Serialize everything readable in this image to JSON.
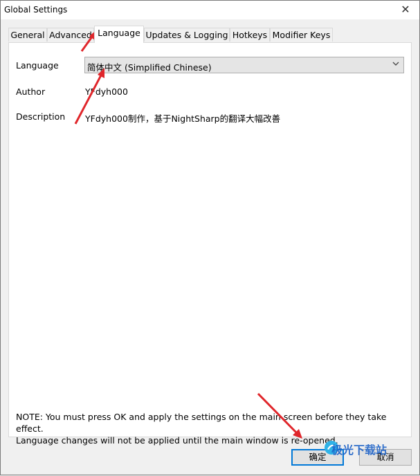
{
  "window": {
    "title": "Global Settings",
    "close_glyph": "✕"
  },
  "tabs": [
    {
      "label": "General"
    },
    {
      "label": "Advanced"
    },
    {
      "label": "Language"
    },
    {
      "label": "Updates & Logging"
    },
    {
      "label": "Hotkeys"
    },
    {
      "label": "Modifier Keys"
    }
  ],
  "active_tab": "Language",
  "language_panel": {
    "language_label": "Language",
    "language_value": "简体中文 (Simplified Chinese)",
    "author_label": "Author",
    "author_value": "YFdyh000",
    "description_label": "Description",
    "description_value": "YFdyh000制作，基于NightSharp的翻译大幅改善"
  },
  "note": {
    "line1": "NOTE: You must press OK and apply the settings on the main screen before they take effect.",
    "line2": "Language changes will not be applied until the main window is re-opened."
  },
  "buttons": {
    "ok_label": "确定",
    "cancel_label": "取消"
  },
  "watermark": {
    "text": "极光下载站"
  },
  "colors": {
    "accent": "#0078d7",
    "annotation_arrow": "#e0262b"
  }
}
